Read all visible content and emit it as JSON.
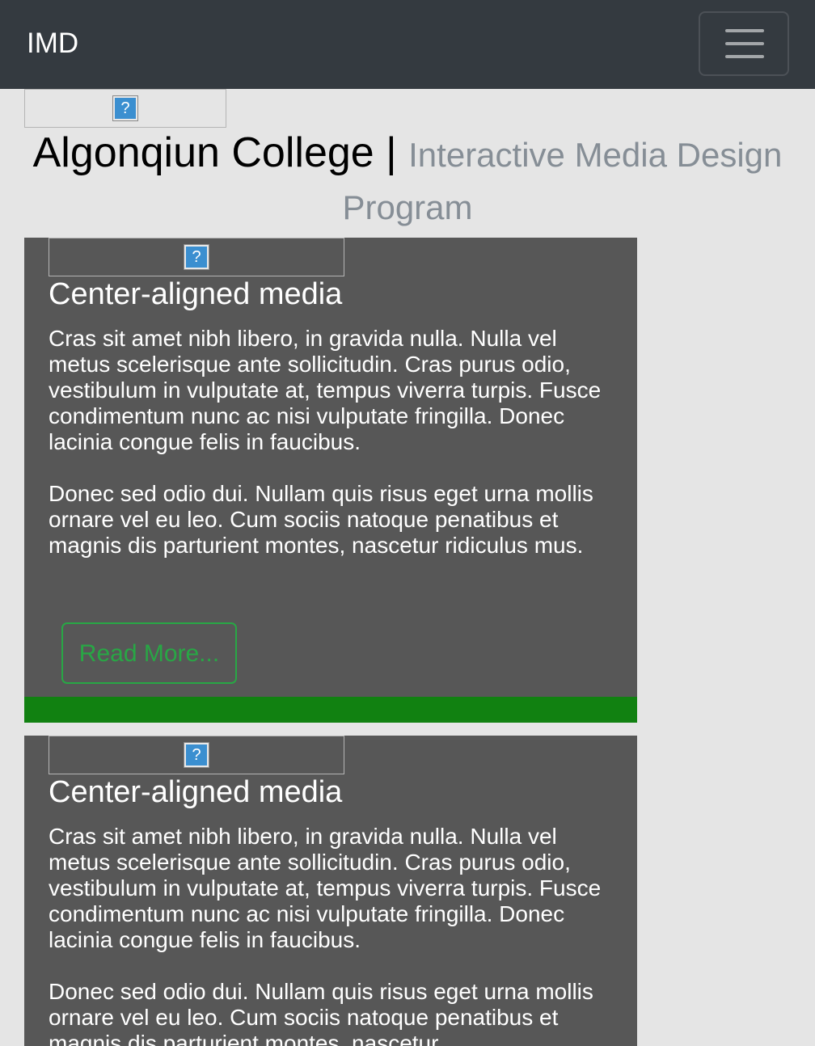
{
  "navbar": {
    "brand": "IMD",
    "toggler_icon": "hamburger-menu-icon"
  },
  "header": {
    "title": "Algonqiun College",
    "separator": "|",
    "subtitle": "Interactive Media Design Program"
  },
  "cards": [
    {
      "title": "Center-aligned media",
      "paragraphs": [
        "Cras sit amet nibh libero, in gravida nulla. Nulla vel metus scelerisque ante sollicitudin. Cras purus odio, vestibulum in vulputate at, tempus viverra turpis. Fusce condimentum nunc ac nisi vulputate fringilla. Donec lacinia congue felis in faucibus.",
        "Donec sed odio dui. Nullam quis risus eget urna mollis ornare vel eu leo. Cum sociis natoque penatibus et magnis dis parturient montes, nascetur ridiculus mus."
      ],
      "button": "Read More..."
    },
    {
      "title": "Center-aligned media",
      "paragraphs": [
        "Cras sit amet nibh libero, in gravida nulla. Nulla vel metus scelerisque ante sollicitudin. Cras purus odio, vestibulum in vulputate at, tempus viverra turpis. Fusce condimentum nunc ac nisi vulputate fringilla. Donec lacinia congue felis in faucibus.",
        "Donec sed odio dui. Nullam quis risus eget urna mollis ornare vel eu leo. Cum sociis natoque penatibus et magnis dis parturient montes, nascetur"
      ]
    }
  ],
  "colors": {
    "navbar": "#343a40",
    "card": "#575757",
    "accent_green": "#28a745",
    "bar_green": "#118111",
    "muted": "#868e96"
  }
}
